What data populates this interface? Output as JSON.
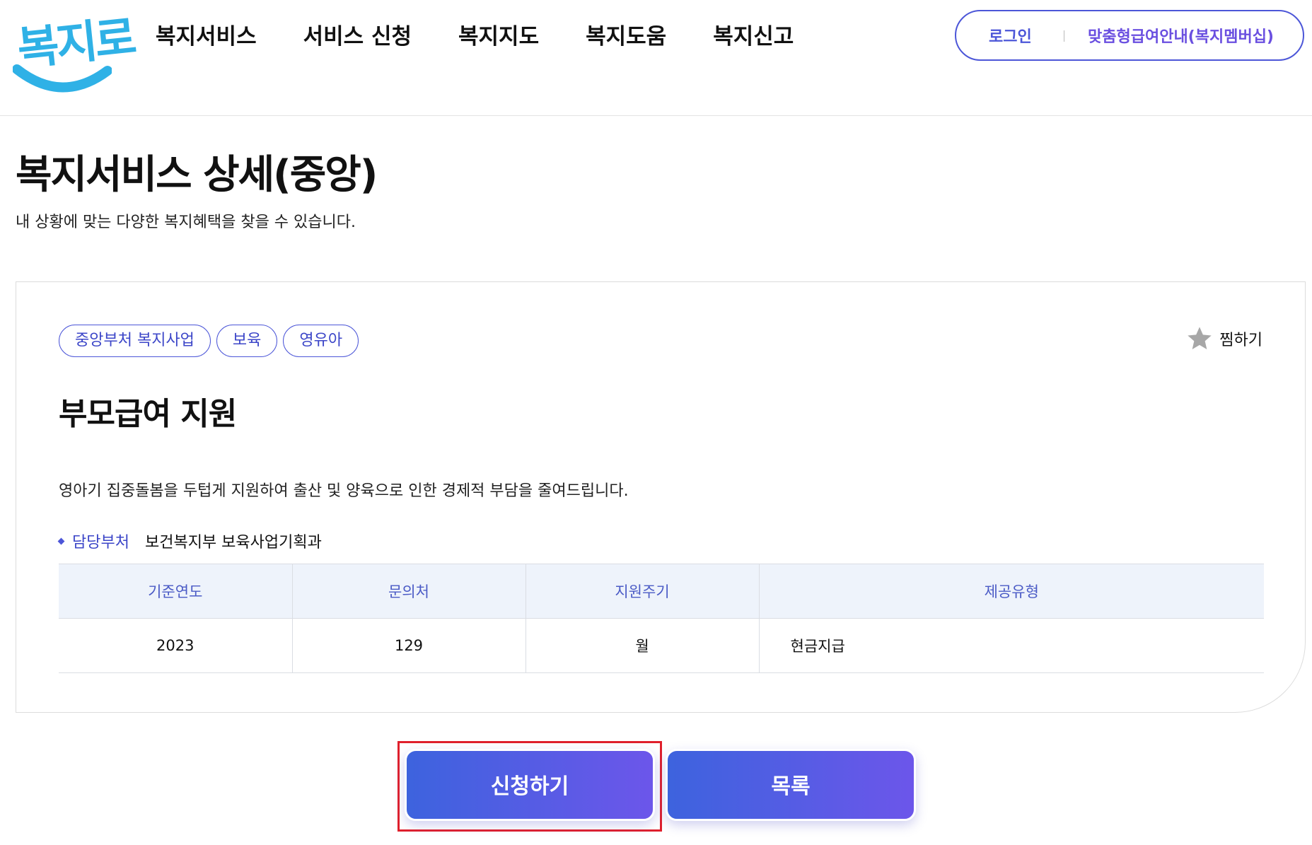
{
  "header": {
    "logo_text": "복지로",
    "nav": [
      "복지서비스",
      "서비스 신청",
      "복지지도",
      "복지도움",
      "복지신고"
    ],
    "login_label": "로그인",
    "membership_label": "맞춤형급여안내(복지멤버십)"
  },
  "page": {
    "title": "복지서비스 상세(중앙)",
    "description": "내 상황에 맞는 다양한 복지혜택을 찾을 수 있습니다."
  },
  "service": {
    "tags": [
      "중앙부처 복지사업",
      "보육",
      "영유아"
    ],
    "favorite_label": "찜하기",
    "title": "부모급여 지원",
    "description": "영아기 집중돌봄을 두텁게 지원하여 출산 및 양육으로 인한 경제적 부담을 줄여드립니다.",
    "department_label": "담당부처",
    "department_value": "보건복지부 보육사업기획과",
    "table": {
      "headers": [
        "기준연도",
        "문의처",
        "지원주기",
        "제공유형"
      ],
      "row": [
        "2023",
        "129",
        "월",
        "현금지급"
      ]
    }
  },
  "buttons": {
    "apply_label": "신청하기",
    "list_label": "목록"
  },
  "colors": {
    "brand_blue": "#4c56d8",
    "logo_sky": "#2fb1e6",
    "highlight_red": "#e0202c",
    "table_header_bg": "#eef3fb"
  }
}
